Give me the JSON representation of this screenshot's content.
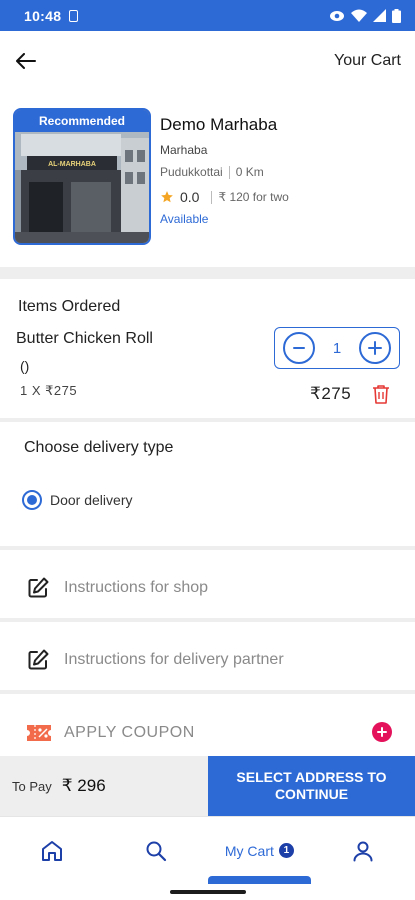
{
  "status_bar": {
    "time": "10:48"
  },
  "header": {
    "title": "Your Cart"
  },
  "shop": {
    "badge": "Recommended",
    "name": "Demo Marhaba",
    "subtitle": "Marhaba",
    "location": "Pudukkottai",
    "distance": "0 Km",
    "rating": "0.0",
    "price_for_two": "₹ 120 for two",
    "status": "Available",
    "signboard_text": "AL-MARHABA"
  },
  "items": {
    "title": "Items Ordered",
    "list": [
      {
        "name": "Butter Chicken Roll",
        "variant": "()",
        "qty_price": "1 X  ₹275",
        "quantity": "1",
        "total": "₹275"
      }
    ]
  },
  "delivery": {
    "title": "Choose delivery type",
    "option": "Door delivery"
  },
  "instructions": {
    "shop": "Instructions for shop",
    "partner": "Instructions for delivery partner"
  },
  "coupon": {
    "label": "APPLY COUPON"
  },
  "payment": {
    "label": "To Pay",
    "amount": "₹ 296",
    "button": "SELECT ADDRESS TO CONTINUE"
  },
  "nav": {
    "cart_label": "My Cart",
    "cart_count": "1"
  },
  "colors": {
    "primary": "#2e6ad6",
    "accent_pink": "#e3125a",
    "rating_star": "#f4a523",
    "delete_red": "#e53935"
  },
  "icons": [
    "back-arrow-icon",
    "star-icon",
    "minus-icon",
    "plus-icon",
    "trash-icon",
    "edit-icon",
    "coupon-icon",
    "home-icon",
    "search-icon",
    "user-icon"
  ]
}
